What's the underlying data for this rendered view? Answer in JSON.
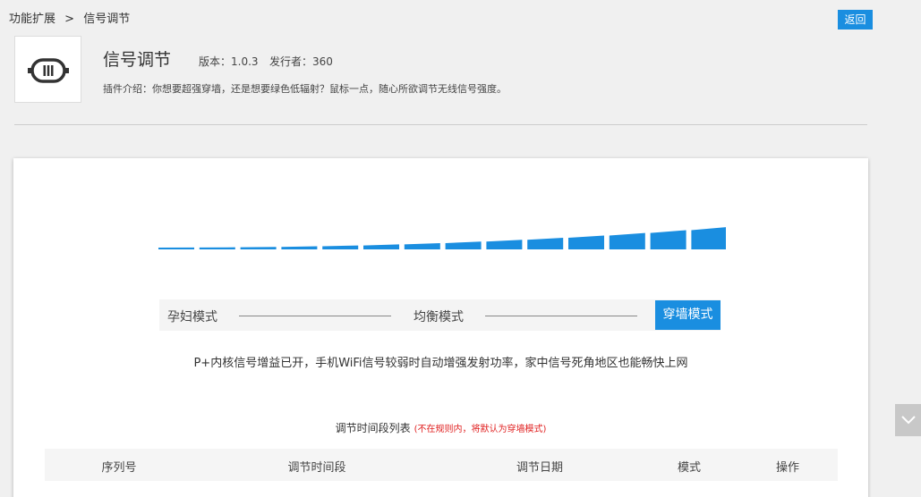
{
  "breadcrumb": {
    "parent": "功能扩展",
    "separator": ">",
    "current": "信号调节"
  },
  "header": {
    "back_label": "返回",
    "title": "信号调节",
    "version_label": "版本：1.0.3",
    "publisher_label": "发行者：360",
    "description": "插件介绍：你想要超强穿墙，还是想要绿色低辐射？鼠标一点，随心所欲调节无线信号强度。",
    "icon": "router-antenna-icon"
  },
  "signal": {
    "level_fraction": 1.0,
    "bar_count": 14,
    "color": "#1a8ee0"
  },
  "modes": {
    "items": [
      "孕妇模式",
      "均衡模式",
      "穿墙模式"
    ],
    "selected": "穿墙模式",
    "description": "P+内核信号增益已开，手机WiFi信号较弱时自动增强发射功率，家中信号死角地区也能畅快上网"
  },
  "schedule": {
    "title": "调节时间段列表",
    "note": "(不在规则内，将默认为穿墙模式)",
    "columns": [
      "序列号",
      "调节时间段",
      "调节日期",
      "模式",
      "操作"
    ]
  },
  "colors": {
    "accent": "#1a8ee0",
    "warning_text": "#e02020"
  }
}
